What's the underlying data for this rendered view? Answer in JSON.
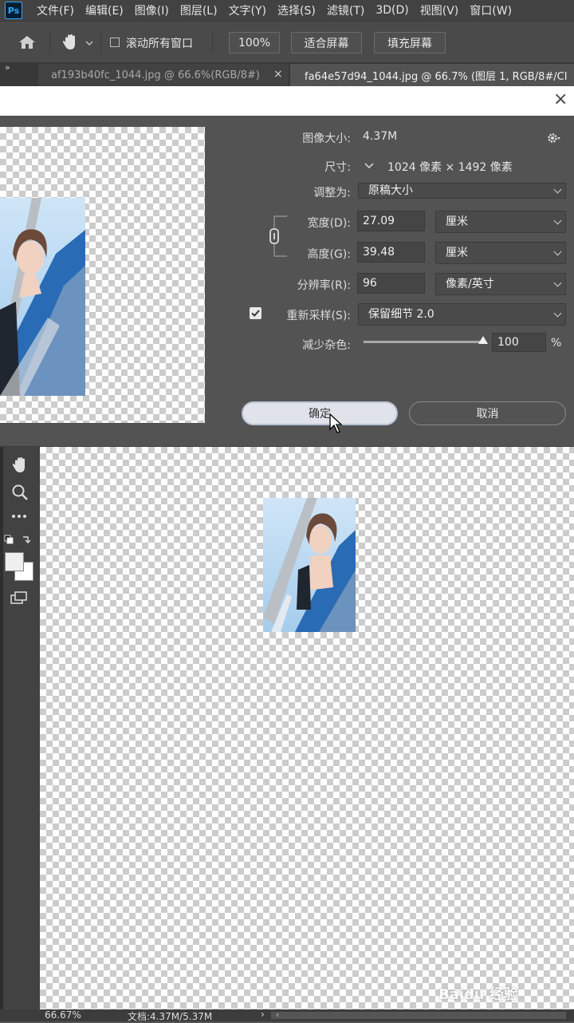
{
  "app": {
    "logo": "Ps"
  },
  "menu": [
    "文件(F)",
    "编辑(E)",
    "图像(I)",
    "图层(L)",
    "文字(Y)",
    "选择(S)",
    "滤镜(T)",
    "3D(D)",
    "视图(V)",
    "窗口(W)"
  ],
  "options_bar": {
    "scroll_all_label": "滚动所有窗口",
    "zoom_label": "100%",
    "fit_screen_label": "适合屏幕",
    "fill_screen_label": "填充屏幕"
  },
  "tabs": [
    {
      "title": "af193b40fc_1044.jpg @ 66.6%(RGB/8#)",
      "close": "×"
    },
    {
      "title": "fa64e57d94_1044.jpg @ 66.7% (图层 1, RGB/8#/CI",
      "close": ""
    }
  ],
  "dialog": {
    "close_icon": "×",
    "image_size_label": "图像大小:",
    "image_size_value": "4.37M",
    "dimensions_label": "尺寸:",
    "dimensions_value": "1024 像素 × 1492 像素",
    "fit_to_label": "调整为:",
    "fit_to_value": "原稿大小",
    "width_label": "宽度(D):",
    "width_value": "27.09",
    "width_unit": "厘米",
    "height_label": "高度(G):",
    "height_value": "39.48",
    "height_unit": "厘米",
    "resolution_label": "分辨率(R):",
    "resolution_value": "96",
    "resolution_unit": "像素/英寸",
    "resample_label": "重新采样(S):",
    "resample_checked": true,
    "resample_value": "保留细节 2.0",
    "noise_label": "减少杂色:",
    "noise_value": "100",
    "noise_unit": "%",
    "noise_level": 1.0,
    "ok_label": "确定",
    "cancel_label": "取消"
  },
  "status": {
    "zoom": "66.67%",
    "doc_info": "文档:4.37M/5.37M"
  },
  "watermark": "Baidu 经验",
  "colors": {
    "accent": "#31a8ff",
    "panel": "#535353",
    "menubar": "#424242"
  }
}
